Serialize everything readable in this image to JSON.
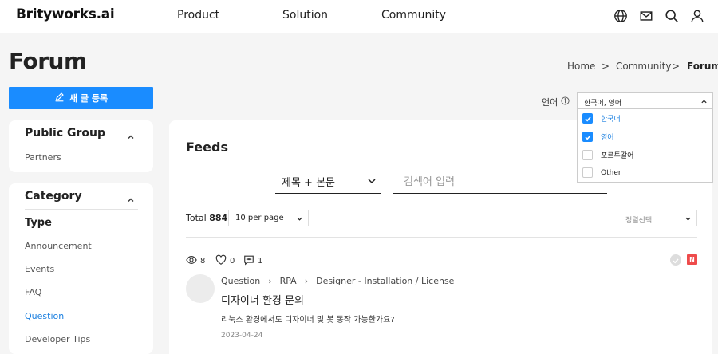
{
  "brand": {
    "logo": "Brityworks.ai"
  },
  "nav": {
    "items": [
      "Product",
      "Solution",
      "Community"
    ]
  },
  "page": {
    "title": "Forum"
  },
  "breadcrumb": {
    "items": [
      "Home",
      "Community",
      "Forum"
    ],
    "separator": ">"
  },
  "new_post": {
    "label": "새 글 등록"
  },
  "sidebar": {
    "public_group": {
      "title": "Public Group",
      "items": [
        "Partners"
      ]
    },
    "category": {
      "title": "Category",
      "type_label": "Type",
      "items": [
        "Announcement",
        "Events",
        "FAQ",
        "Question",
        "Developer Tips"
      ],
      "active": "Question"
    }
  },
  "language": {
    "label": "언어",
    "selected": "한국어, 영어",
    "options": [
      {
        "label": "한국어",
        "checked": true
      },
      {
        "label": "영어",
        "checked": true
      },
      {
        "label": "포르투갈어",
        "checked": false
      },
      {
        "label": "Other",
        "checked": false
      }
    ]
  },
  "feeds": {
    "title": "Feeds",
    "search_type": "제목 + 본문",
    "search_placeholder": "검색어 입력",
    "total_label": "Total",
    "total_count": "884",
    "per_page": "10 per page",
    "sort_placeholder": "정렬선택"
  },
  "post": {
    "views": "8",
    "likes": "0",
    "comments": "1",
    "new_badge": "N",
    "crumbs": [
      "Question",
      "RPA",
      "Designer - Installation / License"
    ],
    "title": "디자이너 환경 문의",
    "excerpt": "리눅스 환경에서도 디자이너 및 봇 동작 가능한가요?",
    "date": "2023-04-24"
  },
  "colors": {
    "accent": "#1a8cff",
    "badge": "#ee4b4b",
    "active_link": "#1a7fe0"
  }
}
